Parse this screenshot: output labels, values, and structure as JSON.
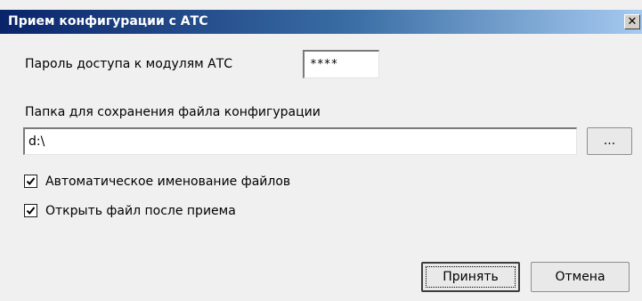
{
  "window": {
    "title": "Прием конфигурации с АТС"
  },
  "password": {
    "label": "Пароль доступа к модулям АТС",
    "value": "****"
  },
  "folder": {
    "label": "Папка для сохранения файла конфигурации",
    "value": "d:\\",
    "browse_label": "..."
  },
  "options": [
    {
      "label": "Автоматическое именование файлов",
      "checked": true
    },
    {
      "label": "Открыть файл после приема",
      "checked": true
    }
  ],
  "buttons": {
    "accept": "Принять",
    "cancel": "Отмена"
  },
  "icons": {
    "close": "close-icon",
    "check": "checkmark-icon"
  }
}
